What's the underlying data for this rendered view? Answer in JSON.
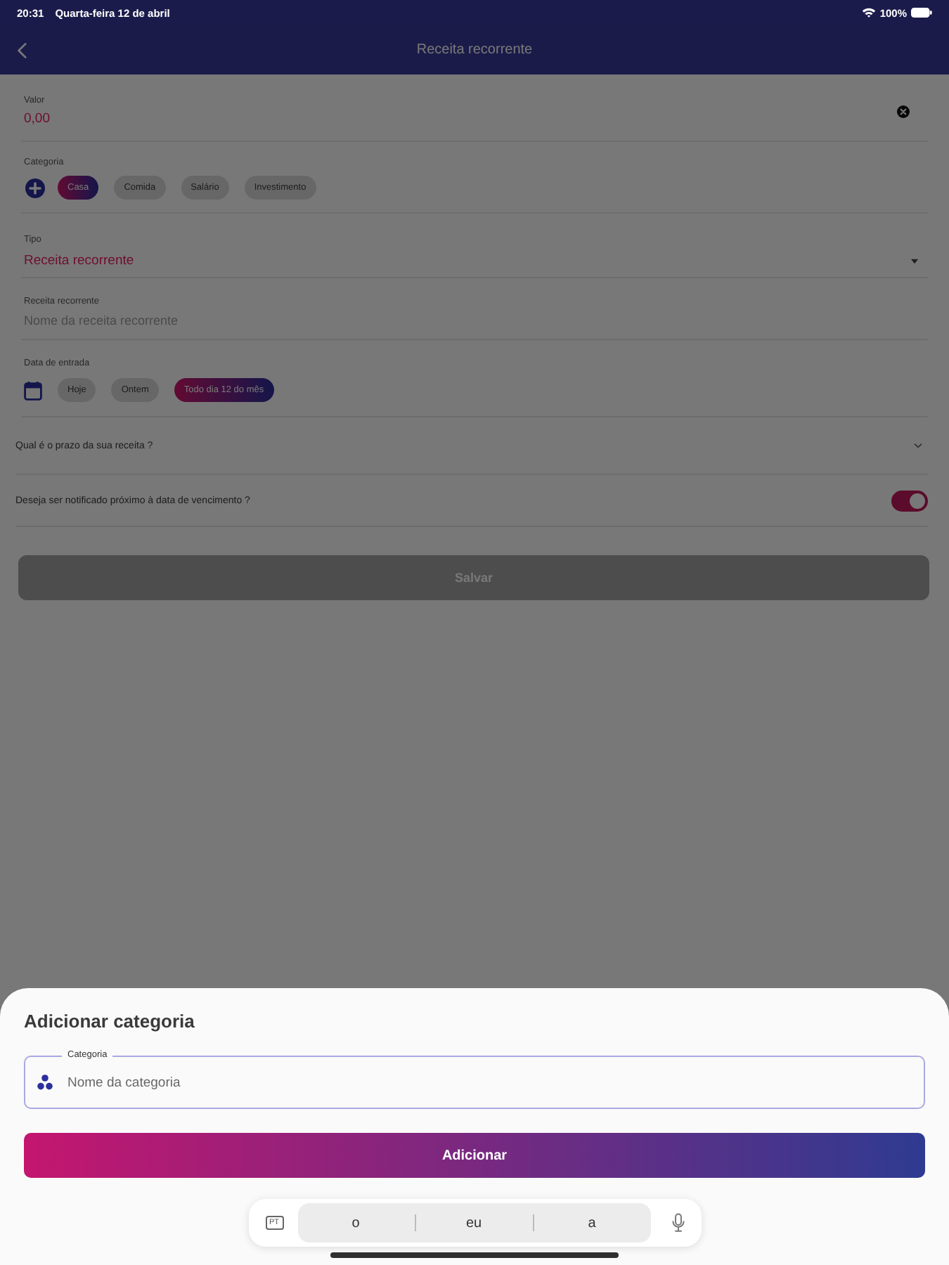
{
  "status_bar": {
    "time": "20:31",
    "date": "Quarta-feira 12 de abril",
    "battery": "100%"
  },
  "nav_bar": {
    "title": "Receita recorrente"
  },
  "form": {
    "valor": {
      "label": "Valor",
      "value": "0,00"
    },
    "categoria": {
      "label": "Categoria",
      "chips": [
        {
          "label": "Casa",
          "selected": true
        },
        {
          "label": "Comida",
          "selected": false
        },
        {
          "label": "Salário",
          "selected": false
        },
        {
          "label": "Investimento",
          "selected": false
        }
      ]
    },
    "tipo": {
      "label": "Tipo",
      "value": "Receita recorrente"
    },
    "nome": {
      "label": "Receita recorrente",
      "placeholder": "Nome da receita recorrente"
    },
    "data_entrada": {
      "label": "Data de entrada",
      "chips": [
        {
          "label": "Hoje",
          "selected": false
        },
        {
          "label": "Ontem",
          "selected": false
        },
        {
          "label": "Todo dia 12 do mês",
          "selected": true
        }
      ]
    },
    "prazo": {
      "label": "Qual é o prazo da sua receita ?"
    },
    "notificar": {
      "label": "Deseja ser notificado próximo à data de vencimento ?",
      "on": true
    },
    "save_button": {
      "label": "Salvar",
      "disabled": true
    }
  },
  "sheet": {
    "title": "Adicionar categoria",
    "field": {
      "label": "Categoria",
      "placeholder": "Nome da categoria"
    },
    "button": "Adicionar"
  },
  "keyboard_bar": {
    "language": "PT",
    "suggestions": [
      "o",
      "eu",
      "a"
    ]
  }
}
